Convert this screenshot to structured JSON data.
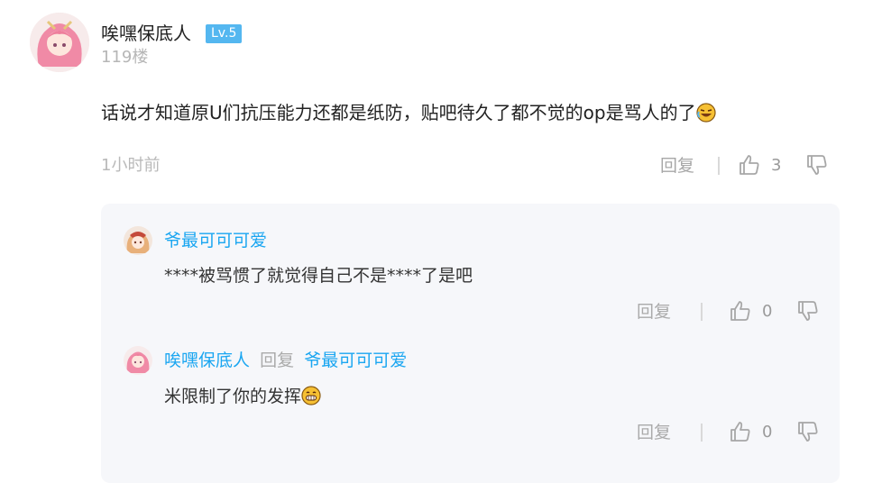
{
  "comment": {
    "user": "唉嘿保底人",
    "level": "Lv.5",
    "floor": "119楼",
    "text": "话说才知道原U们抗压能力还都是纸防，贴吧待久了都不觉的op是骂人的了",
    "time": "1小时前",
    "reply_label": "回复",
    "like_count": "3"
  },
  "replies": [
    {
      "user": "爷最可可可爱",
      "text": "****被骂惯了就觉得自己不是****了是吧",
      "reply_label": "回复",
      "like_count": "0"
    },
    {
      "user": "唉嘿保底人",
      "reply_word": "回复",
      "reply_to": "爷最可可可爱",
      "text": "米限制了你的发挥",
      "reply_label": "回复",
      "like_count": "0"
    }
  ],
  "icons": [
    "avatar",
    "laugh-cry-emoji",
    "grin-emoji",
    "thumb-up-icon",
    "thumb-down-icon"
  ],
  "colors": {
    "level_badge": "#54b7f0",
    "link_blue": "#1aa6f1",
    "reply_box_bg": "#f6f7fa"
  }
}
